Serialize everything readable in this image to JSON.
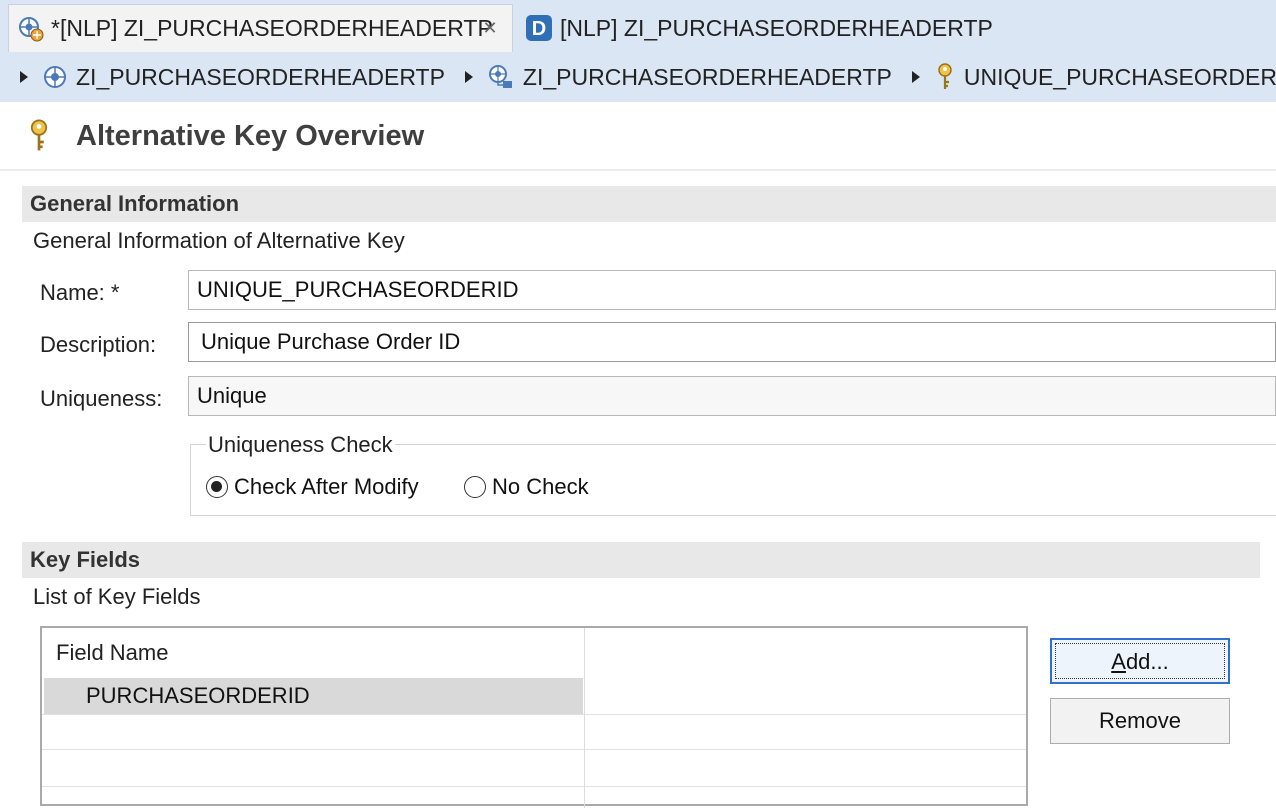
{
  "tabs": [
    {
      "label": "*[NLP] ZI_PURCHASEORDERHEADERTP",
      "icon": "behavior-definition-icon",
      "active": true
    },
    {
      "label": "[NLP] ZI_PURCHASEORDERHEADERTP",
      "icon": "data-definition-icon",
      "active": false
    }
  ],
  "tab_close_glyph": "✕",
  "breadcrumb": [
    {
      "label": "ZI_PURCHASEORDERHEADERTP",
      "icon": "entity-icon"
    },
    {
      "label": "ZI_PURCHASEORDERHEADERTP",
      "icon": "node-structure-icon"
    },
    {
      "label": "UNIQUE_PURCHASEORDERID",
      "icon": "key-icon"
    }
  ],
  "header": {
    "title": "Alternative Key Overview",
    "icon": "key-icon"
  },
  "general": {
    "section_title": "General Information",
    "description": "General Information of Alternative Key",
    "name_label": "Name: *",
    "name_value": "UNIQUE_PURCHASEORDERID",
    "description_label": "Description:",
    "description_value": "Unique Purchase Order ID",
    "uniqueness_label": "Uniqueness:",
    "uniqueness_value": "Unique",
    "check_group_label": "Uniqueness Check",
    "check_options": [
      {
        "label": "Check After Modify",
        "selected": true
      },
      {
        "label": "No Check",
        "selected": false
      }
    ]
  },
  "key_fields": {
    "section_title": "Key Fields",
    "description": "List of Key Fields",
    "column_header": "Field Name",
    "rows": [
      "PURCHASEORDERID"
    ],
    "add_label_accel": "A",
    "add_label_rest": "dd...",
    "remove_label": "Remove"
  },
  "colors": {
    "accent": "#2e6fd0",
    "tab_strip": "#dbe6f4",
    "section_bar": "#e8e8e8"
  }
}
